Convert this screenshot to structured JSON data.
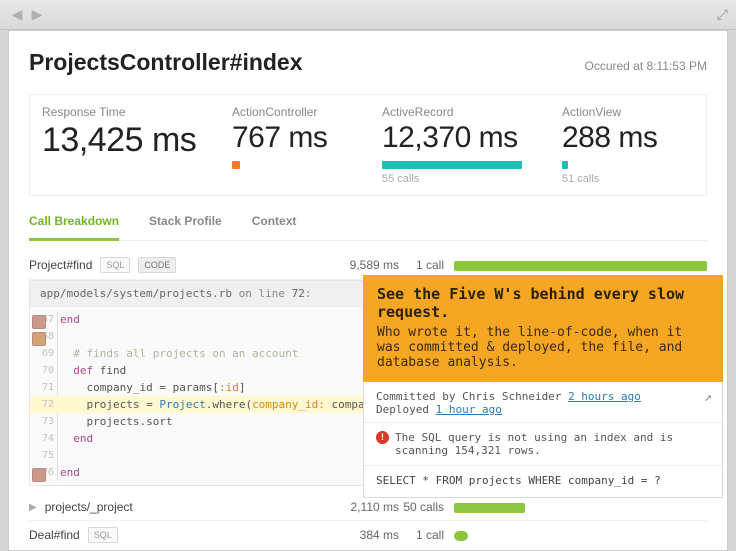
{
  "title": "ProjectsController#index",
  "occurred": "Occured at 8:11:53 PM",
  "metrics": {
    "response_time": {
      "label": "Response Time",
      "value": "13,425 ms"
    },
    "action_controller": {
      "label": "ActionController",
      "value": "767 ms"
    },
    "active_record": {
      "label": "ActiveRecord",
      "value": "12,370 ms",
      "calls": "55 calls"
    },
    "action_view": {
      "label": "ActionView",
      "value": "288 ms",
      "calls": "51 calls"
    }
  },
  "tabs": {
    "breakdown": "Call Breakdown",
    "stack": "Stack Profile",
    "context": "Context"
  },
  "rows": {
    "r1": {
      "name": "Project#find",
      "sql": "SQL",
      "code": "CODE",
      "time": "9,589 ms",
      "calls": "1 call"
    },
    "r2": {
      "name": "projects/_project",
      "time": "2,110 ms",
      "calls": "50 calls"
    },
    "r3": {
      "name": "Deal#find",
      "sql": "SQL",
      "time": "384 ms",
      "calls": "1 call"
    }
  },
  "code": {
    "path": "app/models/system/projects.rb",
    "online": " on line ",
    "linenum": "72",
    "colon": ":",
    "lines": {
      "67": "end",
      "68": "",
      "69": "  # finds all projects on an account",
      "70": "  def find",
      "71": "    company_id = params[:id]",
      "72": "    projects = Project.where(company_id: company_id)",
      "73": "    projects.sort",
      "74": "  end",
      "75": "",
      "76": "end"
    }
  },
  "popover": {
    "headline": "See the Five W's behind every slow request.",
    "sub": "Who wrote it, the line-of-code, when it was committed & deployed, the file, and database analysis.",
    "committed_by_pre": "Committed by Chris Schneider ",
    "committed_link": "2 hours ago",
    "deployed_pre": "Deployed ",
    "deployed_link": "1 hour ago",
    "warn": "The SQL query is not using an index and is scanning 154,321 rows.",
    "sql": "SELECT * FROM projects WHERE company_id = ?"
  },
  "ln": {
    "67": "67",
    "68": "68",
    "69": "69",
    "70": "70",
    "71": "71",
    "72": "72",
    "73": "73",
    "74": "74",
    "75": "75",
    "76": "76"
  }
}
